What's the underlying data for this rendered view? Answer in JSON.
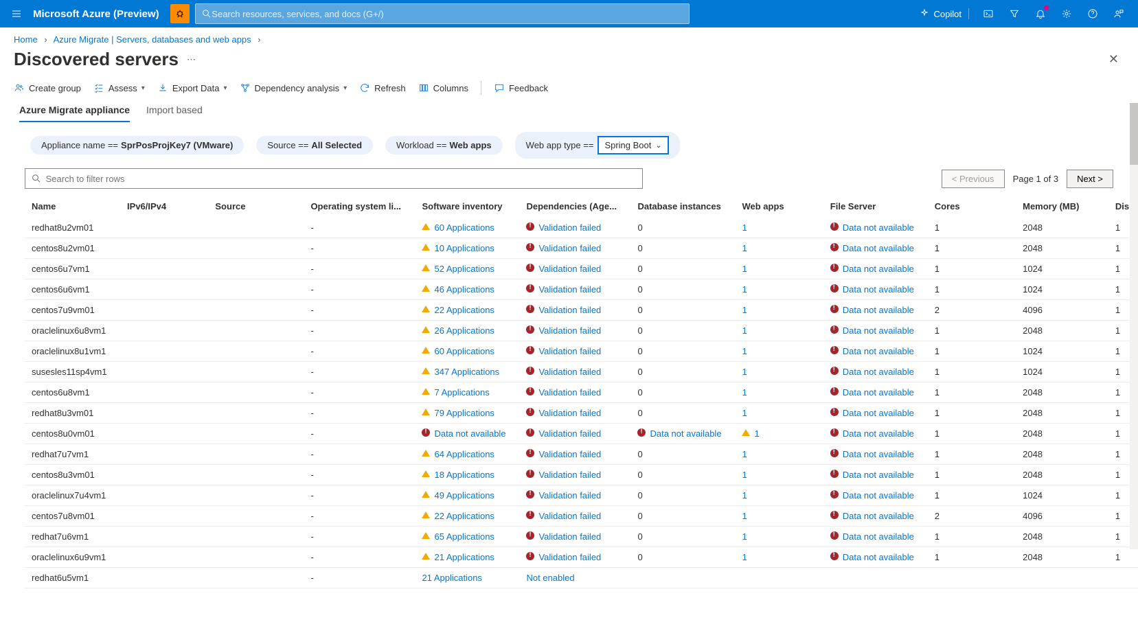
{
  "header": {
    "brand": "Microsoft Azure (Preview)",
    "search_placeholder": "Search resources, services, and docs (G+/)",
    "copilot": "Copilot"
  },
  "breadcrumbs": {
    "home": "Home",
    "parent": "Azure Migrate | Servers, databases and web apps"
  },
  "page": {
    "title": "Discovered servers"
  },
  "toolbar": {
    "create_group": "Create group",
    "assess": "Assess",
    "export": "Export Data",
    "dep_analysis": "Dependency analysis",
    "refresh": "Refresh",
    "columns": "Columns",
    "feedback": "Feedback"
  },
  "tabs": {
    "appliance": "Azure Migrate appliance",
    "import": "Import based"
  },
  "filters": {
    "appliance_label": "Appliance name ==",
    "appliance_value": "SprPosProjKey7 (VMware)",
    "source_label": "Source ==",
    "source_value": "All Selected",
    "workload_label": "Workload ==",
    "workload_value": "Web apps",
    "webapp_label": "Web app type ==",
    "webapp_value": "Spring Boot"
  },
  "search": {
    "placeholder": "Search to filter rows"
  },
  "pager": {
    "prev": "< Previous",
    "info": "Page 1 of 3",
    "next": "Next >"
  },
  "columns": {
    "name": "Name",
    "ip": "IPv6/IPv4",
    "source": "Source",
    "os": "Operating system li...",
    "inv": "Software inventory",
    "dep": "Dependencies (Age...",
    "db": "Database instances",
    "web": "Web apps",
    "fs": "File Server",
    "cores": "Cores",
    "mem": "Memory (MB)",
    "dis": "Dis"
  },
  "text": {
    "validation_failed": "Validation failed",
    "data_na": "Data not available",
    "not_enabled": "Not enabled"
  },
  "rows": [
    {
      "name": "redhat8u2vm01",
      "os": "-",
      "inv": "60 Applications",
      "inv_icon": "warn",
      "dep": "vf",
      "db": "0",
      "web": "1",
      "fs": "na",
      "cores": "1",
      "mem": "2048",
      "dis": "1"
    },
    {
      "name": "centos8u2vm01",
      "os": "-",
      "inv": "10 Applications",
      "inv_icon": "warn",
      "dep": "vf",
      "db": "0",
      "web": "1",
      "fs": "na",
      "cores": "1",
      "mem": "2048",
      "dis": "1"
    },
    {
      "name": "centos6u7vm1",
      "os": "-",
      "inv": "52 Applications",
      "inv_icon": "warn",
      "dep": "vf",
      "db": "0",
      "web": "1",
      "fs": "na",
      "cores": "1",
      "mem": "1024",
      "dis": "1"
    },
    {
      "name": "centos6u6vm1",
      "os": "-",
      "inv": "46 Applications",
      "inv_icon": "warn",
      "dep": "vf",
      "db": "0",
      "web": "1",
      "fs": "na",
      "cores": "1",
      "mem": "1024",
      "dis": "1"
    },
    {
      "name": "centos7u9vm01",
      "os": "-",
      "inv": "22 Applications",
      "inv_icon": "warn",
      "dep": "vf",
      "db": "0",
      "web": "1",
      "fs": "na",
      "cores": "2",
      "mem": "4096",
      "dis": "1"
    },
    {
      "name": "oraclelinux6u8vm1",
      "os": "-",
      "inv": "26 Applications",
      "inv_icon": "warn",
      "dep": "vf",
      "db": "0",
      "web": "1",
      "fs": "na",
      "cores": "1",
      "mem": "2048",
      "dis": "1"
    },
    {
      "name": "oraclelinux8u1vm1",
      "os": "-",
      "inv": "60 Applications",
      "inv_icon": "warn",
      "dep": "vf",
      "db": "0",
      "web": "1",
      "fs": "na",
      "cores": "1",
      "mem": "1024",
      "dis": "1"
    },
    {
      "name": "susesles11sp4vm1",
      "os": "-",
      "inv": "347 Applications",
      "inv_icon": "warn",
      "dep": "vf",
      "db": "0",
      "web": "1",
      "fs": "na",
      "cores": "1",
      "mem": "1024",
      "dis": "1"
    },
    {
      "name": "centos6u8vm1",
      "os": "-",
      "inv": "7 Applications",
      "inv_icon": "warn",
      "dep": "vf",
      "db": "0",
      "web": "1",
      "fs": "na",
      "cores": "1",
      "mem": "2048",
      "dis": "1"
    },
    {
      "name": "redhat8u3vm01",
      "os": "-",
      "inv": "79 Applications",
      "inv_icon": "warn",
      "dep": "vf",
      "db": "0",
      "web": "1",
      "fs": "na",
      "cores": "1",
      "mem": "2048",
      "dis": "1"
    },
    {
      "name": "centos8u0vm01",
      "os": "-",
      "inv": "Data not available",
      "inv_icon": "err",
      "dep": "vf",
      "db": "na",
      "web": "warn1",
      "fs": "na",
      "cores": "1",
      "mem": "2048",
      "dis": "1"
    },
    {
      "name": "redhat7u7vm1",
      "os": "-",
      "inv": "64 Applications",
      "inv_icon": "warn",
      "dep": "vf",
      "db": "0",
      "web": "1",
      "fs": "na",
      "cores": "1",
      "mem": "2048",
      "dis": "1"
    },
    {
      "name": "centos8u3vm01",
      "os": "-",
      "inv": "18 Applications",
      "inv_icon": "warn",
      "dep": "vf",
      "db": "0",
      "web": "1",
      "fs": "na",
      "cores": "1",
      "mem": "2048",
      "dis": "1"
    },
    {
      "name": "oraclelinux7u4vm1",
      "os": "-",
      "inv": "49 Applications",
      "inv_icon": "warn",
      "dep": "vf",
      "db": "0",
      "web": "1",
      "fs": "na",
      "cores": "1",
      "mem": "1024",
      "dis": "1"
    },
    {
      "name": "centos7u8vm01",
      "os": "-",
      "inv": "22 Applications",
      "inv_icon": "warn",
      "dep": "vf",
      "db": "0",
      "web": "1",
      "fs": "na",
      "cores": "2",
      "mem": "4096",
      "dis": "1"
    },
    {
      "name": "redhat7u6vm1",
      "os": "-",
      "inv": "65 Applications",
      "inv_icon": "warn",
      "dep": "vf",
      "db": "0",
      "web": "1",
      "fs": "na",
      "cores": "1",
      "mem": "2048",
      "dis": "1"
    },
    {
      "name": "oraclelinux6u9vm1",
      "os": "-",
      "inv": "21 Applications",
      "inv_icon": "warn",
      "dep": "vf",
      "db": "0",
      "web": "1",
      "fs": "na",
      "cores": "1",
      "mem": "2048",
      "dis": "1"
    },
    {
      "name": "redhat6u5vm1",
      "os": "-",
      "inv": "21 Applications",
      "inv_icon": "",
      "dep": "ne",
      "db": "",
      "web": "",
      "fs": "",
      "cores": "",
      "mem": "",
      "dis": ""
    }
  ]
}
